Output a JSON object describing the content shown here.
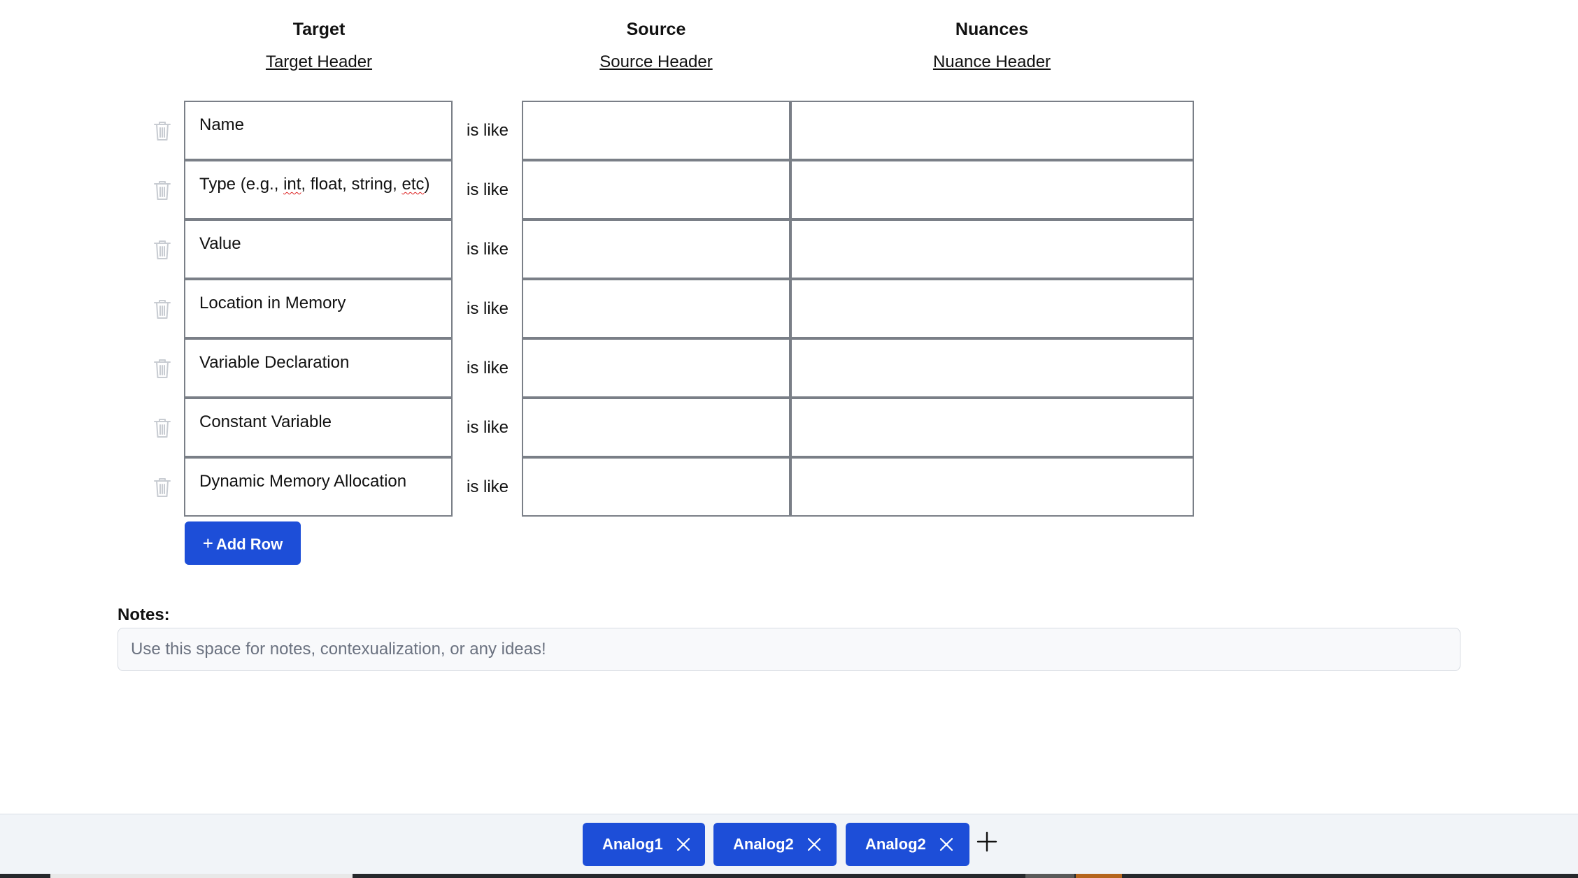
{
  "headers": {
    "target": {
      "title": "Target",
      "link": "Target Header"
    },
    "source": {
      "title": "Source",
      "link": "Source Header"
    },
    "nuances": {
      "title": "Nuances",
      "link": "Nuance Header"
    }
  },
  "rows": [
    {
      "target": "Name",
      "connector": "is like",
      "source": "",
      "nuance": ""
    },
    {
      "target_parts": [
        "Type (e.g., ",
        "int",
        ", float, string, ",
        "etc",
        ")"
      ],
      "connector": "is like",
      "source": "",
      "nuance": ""
    },
    {
      "target": "Value",
      "connector": "is like",
      "source": "",
      "nuance": ""
    },
    {
      "target": "Location in Memory",
      "connector": "is like",
      "source": "",
      "nuance": ""
    },
    {
      "target": "Variable Declaration",
      "connector": "is like",
      "source": "",
      "nuance": ""
    },
    {
      "target": "Constant Variable",
      "connector": "is like",
      "source": "",
      "nuance": ""
    },
    {
      "target": "Dynamic Memory Allocation",
      "connector": "is like",
      "source": "",
      "nuance": ""
    }
  ],
  "add_row": {
    "icon": "+",
    "label": "Add Row"
  },
  "notes": {
    "label": "Notes:",
    "value": "",
    "placeholder": "Use this space for notes, contexualization, or any ideas!"
  },
  "tabs": [
    {
      "label": "Analog1"
    },
    {
      "label": "Analog2"
    },
    {
      "label": "Analog2"
    }
  ],
  "colors": {
    "accent": "#1d4ed8",
    "cell_border": "#7a7f87",
    "tabbar_bg": "#f1f4f8"
  }
}
